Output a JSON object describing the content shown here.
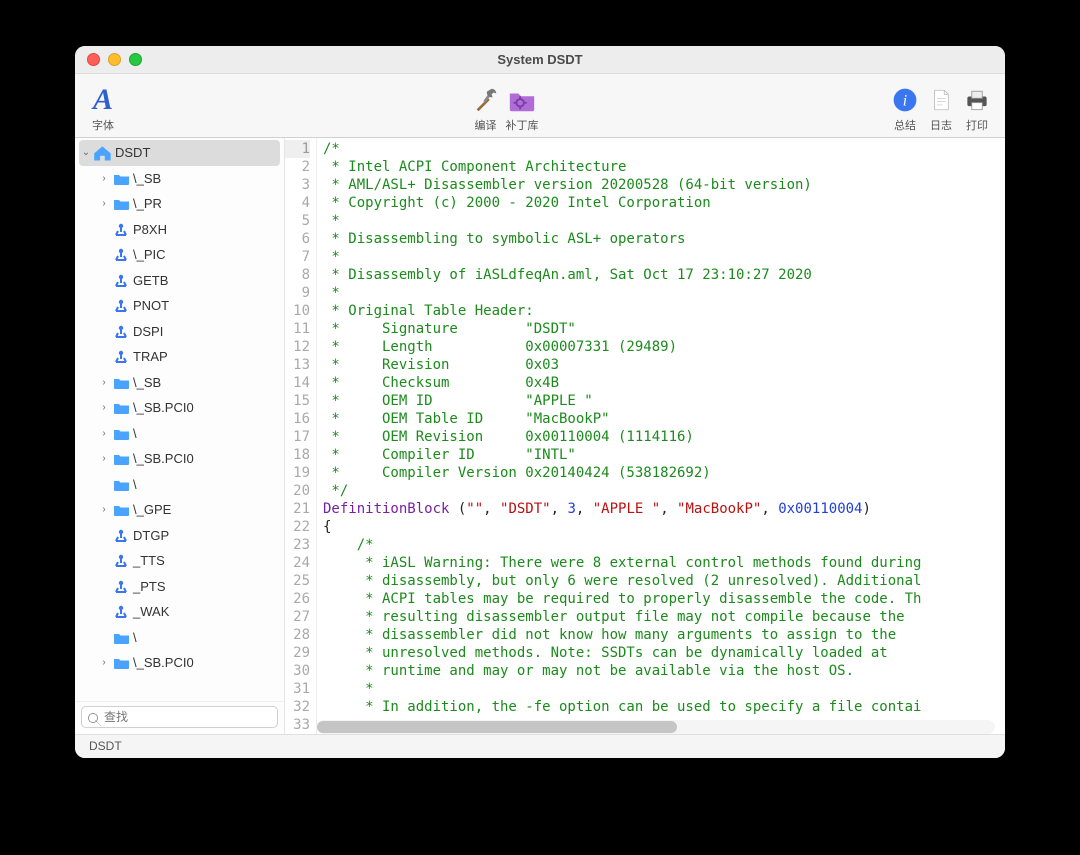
{
  "window": {
    "title": "System DSDT"
  },
  "toolbar": {
    "font": "字体",
    "compile": "编译",
    "patchlib": "补丁库",
    "summary": "总结",
    "log": "日志",
    "print": "打印"
  },
  "sidebar": {
    "items": [
      {
        "depth": 0,
        "kind": "root",
        "disclosure": "open",
        "label": "DSDT",
        "selected": true
      },
      {
        "depth": 1,
        "kind": "folder",
        "disclosure": "closed",
        "label": "\\_SB"
      },
      {
        "depth": 1,
        "kind": "folder",
        "disclosure": "closed",
        "label": "\\_PR"
      },
      {
        "depth": 1,
        "kind": "method",
        "disclosure": "",
        "label": "P8XH"
      },
      {
        "depth": 1,
        "kind": "method",
        "disclosure": "",
        "label": "\\_PIC"
      },
      {
        "depth": 1,
        "kind": "method",
        "disclosure": "",
        "label": "GETB"
      },
      {
        "depth": 1,
        "kind": "method",
        "disclosure": "",
        "label": "PNOT"
      },
      {
        "depth": 1,
        "kind": "method",
        "disclosure": "",
        "label": "DSPI"
      },
      {
        "depth": 1,
        "kind": "method",
        "disclosure": "",
        "label": "TRAP"
      },
      {
        "depth": 1,
        "kind": "folder",
        "disclosure": "closed",
        "label": "\\_SB"
      },
      {
        "depth": 1,
        "kind": "folder",
        "disclosure": "closed",
        "label": "\\_SB.PCI0"
      },
      {
        "depth": 1,
        "kind": "folder",
        "disclosure": "closed",
        "label": "\\"
      },
      {
        "depth": 1,
        "kind": "folder",
        "disclosure": "closed",
        "label": "\\_SB.PCI0"
      },
      {
        "depth": 1,
        "kind": "folder",
        "disclosure": "",
        "label": "\\"
      },
      {
        "depth": 1,
        "kind": "folder",
        "disclosure": "closed",
        "label": "\\_GPE"
      },
      {
        "depth": 1,
        "kind": "method",
        "disclosure": "",
        "label": "DTGP"
      },
      {
        "depth": 1,
        "kind": "method",
        "disclosure": "",
        "label": "_TTS"
      },
      {
        "depth": 1,
        "kind": "method",
        "disclosure": "",
        "label": "_PTS"
      },
      {
        "depth": 1,
        "kind": "method",
        "disclosure": "",
        "label": "_WAK"
      },
      {
        "depth": 1,
        "kind": "folder",
        "disclosure": "",
        "label": "\\"
      },
      {
        "depth": 1,
        "kind": "folder",
        "disclosure": "closed",
        "label": "\\_SB.PCI0"
      }
    ],
    "search_placeholder": "查找"
  },
  "code": {
    "lines": [
      {
        "n": 1,
        "segs": [
          {
            "t": "/*",
            "c": "c"
          }
        ]
      },
      {
        "n": 2,
        "segs": [
          {
            "t": " * Intel ACPI Component Architecture",
            "c": "c"
          }
        ]
      },
      {
        "n": 3,
        "segs": [
          {
            "t": " * AML/ASL+ Disassembler version 20200528 (64-bit version)",
            "c": "c"
          }
        ]
      },
      {
        "n": 4,
        "segs": [
          {
            "t": " * Copyright (c) 2000 - 2020 Intel Corporation",
            "c": "c"
          }
        ]
      },
      {
        "n": 5,
        "segs": [
          {
            "t": " *",
            "c": "c"
          }
        ]
      },
      {
        "n": 6,
        "segs": [
          {
            "t": " * Disassembling to symbolic ASL+ operators",
            "c": "c"
          }
        ]
      },
      {
        "n": 7,
        "segs": [
          {
            "t": " *",
            "c": "c"
          }
        ]
      },
      {
        "n": 8,
        "segs": [
          {
            "t": " * Disassembly of iASLdfeqAn.aml, Sat Oct 17 23:10:27 2020",
            "c": "c"
          }
        ]
      },
      {
        "n": 9,
        "segs": [
          {
            "t": " *",
            "c": "c"
          }
        ]
      },
      {
        "n": 10,
        "segs": [
          {
            "t": " * Original Table Header:",
            "c": "c"
          }
        ]
      },
      {
        "n": 11,
        "segs": [
          {
            "t": " *     Signature        \"DSDT\"",
            "c": "c"
          }
        ]
      },
      {
        "n": 12,
        "segs": [
          {
            "t": " *     Length           0x00007331 (29489)",
            "c": "c"
          }
        ]
      },
      {
        "n": 13,
        "segs": [
          {
            "t": " *     Revision         0x03",
            "c": "c"
          }
        ]
      },
      {
        "n": 14,
        "segs": [
          {
            "t": " *     Checksum         0x4B",
            "c": "c"
          }
        ]
      },
      {
        "n": 15,
        "segs": [
          {
            "t": " *     OEM ID           \"APPLE \"",
            "c": "c"
          }
        ]
      },
      {
        "n": 16,
        "segs": [
          {
            "t": " *     OEM Table ID     \"MacBookP\"",
            "c": "c"
          }
        ]
      },
      {
        "n": 17,
        "segs": [
          {
            "t": " *     OEM Revision     0x00110004 (1114116)",
            "c": "c"
          }
        ]
      },
      {
        "n": 18,
        "segs": [
          {
            "t": " *     Compiler ID      \"INTL\"",
            "c": "c"
          }
        ]
      },
      {
        "n": 19,
        "segs": [
          {
            "t": " *     Compiler Version 0x20140424 (538182692)",
            "c": "c"
          }
        ]
      },
      {
        "n": 20,
        "segs": [
          {
            "t": " */",
            "c": "c"
          }
        ]
      },
      {
        "n": 21,
        "segs": [
          {
            "t": "DefinitionBlock ",
            "c": "fn"
          },
          {
            "t": "(",
            "c": ""
          },
          {
            "t": "\"\"",
            "c": "str"
          },
          {
            "t": ", ",
            "c": ""
          },
          {
            "t": "\"DSDT\"",
            "c": "str"
          },
          {
            "t": ", ",
            "c": ""
          },
          {
            "t": "3",
            "c": "num"
          },
          {
            "t": ", ",
            "c": ""
          },
          {
            "t": "\"APPLE \"",
            "c": "str"
          },
          {
            "t": ", ",
            "c": ""
          },
          {
            "t": "\"MacBookP\"",
            "c": "str"
          },
          {
            "t": ", ",
            "c": ""
          },
          {
            "t": "0x00110004",
            "c": "num"
          },
          {
            "t": ")",
            "c": ""
          }
        ]
      },
      {
        "n": 22,
        "segs": [
          {
            "t": "{",
            "c": ""
          }
        ]
      },
      {
        "n": 23,
        "segs": [
          {
            "t": "    /*",
            "c": "c"
          }
        ]
      },
      {
        "n": 24,
        "segs": [
          {
            "t": "     * iASL Warning: There were 8 external control methods found during",
            "c": "c"
          }
        ]
      },
      {
        "n": 25,
        "segs": [
          {
            "t": "     * disassembly, but only 6 were resolved (2 unresolved). Additional",
            "c": "c"
          }
        ]
      },
      {
        "n": 26,
        "segs": [
          {
            "t": "     * ACPI tables may be required to properly disassemble the code. Th",
            "c": "c"
          }
        ]
      },
      {
        "n": 27,
        "segs": [
          {
            "t": "     * resulting disassembler output file may not compile because the",
            "c": "c"
          }
        ]
      },
      {
        "n": 28,
        "segs": [
          {
            "t": "     * disassembler did not know how many arguments to assign to the",
            "c": "c"
          }
        ]
      },
      {
        "n": 29,
        "segs": [
          {
            "t": "     * unresolved methods. Note: SSDTs can be dynamically loaded at",
            "c": "c"
          }
        ]
      },
      {
        "n": 30,
        "segs": [
          {
            "t": "     * runtime and may or may not be available via the host OS.",
            "c": "c"
          }
        ]
      },
      {
        "n": 31,
        "segs": [
          {
            "t": "     *",
            "c": "c"
          }
        ]
      },
      {
        "n": 32,
        "segs": [
          {
            "t": "     * In addition, the -fe option can be used to specify a file contai",
            "c": "c"
          }
        ]
      },
      {
        "n": 33,
        "segs": [
          {
            "t": " ",
            "c": ""
          }
        ]
      }
    ]
  },
  "statusbar": {
    "text": "DSDT"
  }
}
